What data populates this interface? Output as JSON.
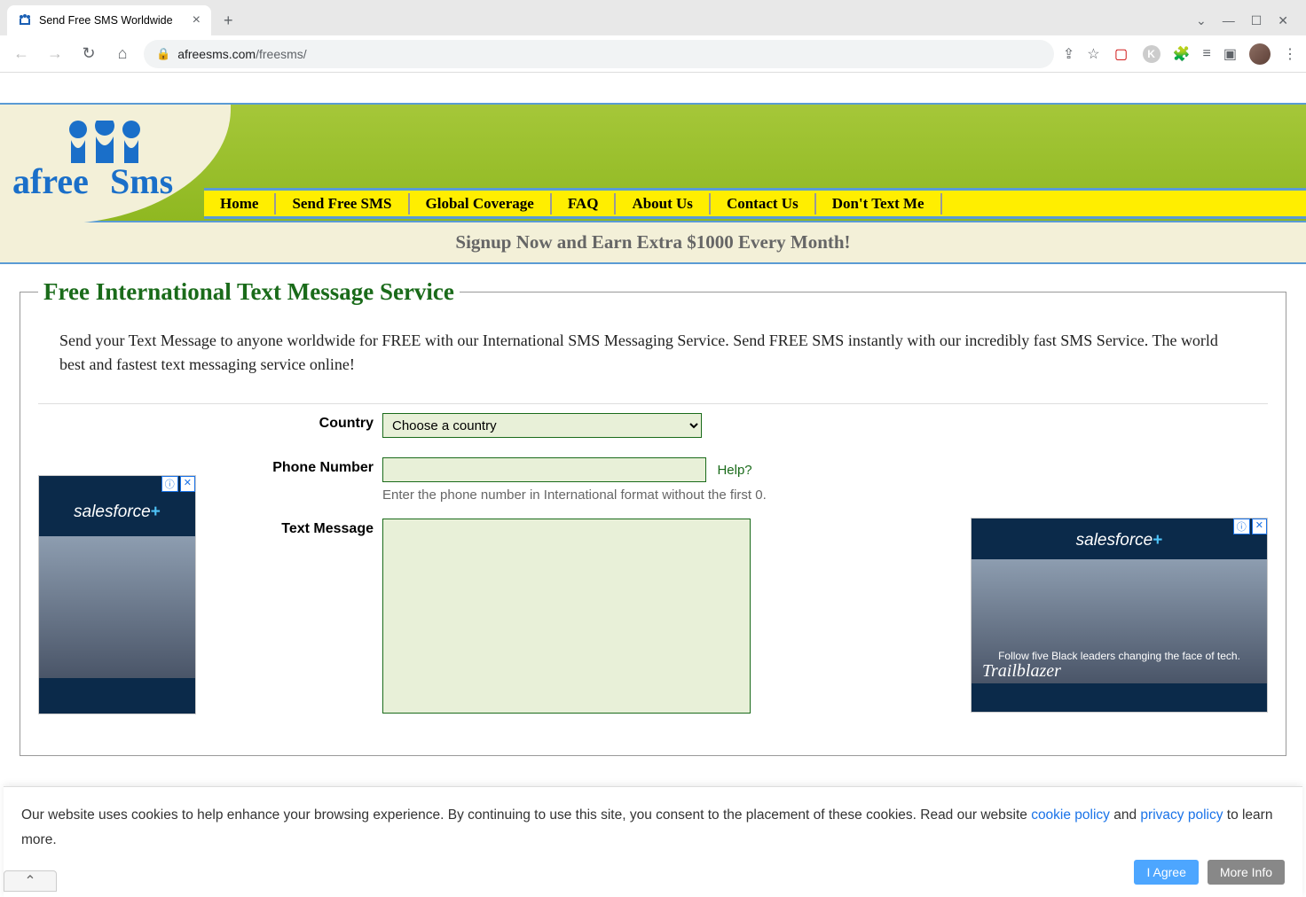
{
  "browser": {
    "tab_title": "Send Free SMS Worldwide",
    "url_domain": "afreesms.com",
    "url_path": "/freesms/"
  },
  "header": {
    "logo_text": "afreeSms",
    "nav": [
      "Home",
      "Send Free SMS",
      "Global Coverage",
      "FAQ",
      "About Us",
      "Contact Us",
      "Don't Text Me"
    ]
  },
  "promo": "Signup Now and Earn Extra $1000 Every Month!",
  "main": {
    "legend": "Free International Text Message Service",
    "intro": "Send your Text Message to anyone worldwide for FREE with our International SMS Messaging Service. Send FREE SMS instantly with our incredibly fast SMS Service. The world best and fastest text messaging service online!",
    "form": {
      "country_label": "Country",
      "country_placeholder": "Choose a country",
      "phone_label": "Phone Number",
      "help_label": "Help?",
      "phone_hint": "Enter the phone number in International format without the first 0.",
      "message_label": "Text Message"
    }
  },
  "ads": {
    "brand": "salesforce",
    "brand_suffix": "+",
    "tagline": "Follow five Black leaders changing the face of tech.",
    "trail": "Trailblazer"
  },
  "cookie": {
    "text_1": "Our website uses cookies to help enhance your browsing experience. By continuing to use this site, you consent to the placement of these cookies. Read our website ",
    "link_1": "cookie policy",
    "text_2": " and ",
    "link_2": "privacy policy",
    "text_3": " to learn more.",
    "agree": "I Agree",
    "more": "More Info"
  }
}
